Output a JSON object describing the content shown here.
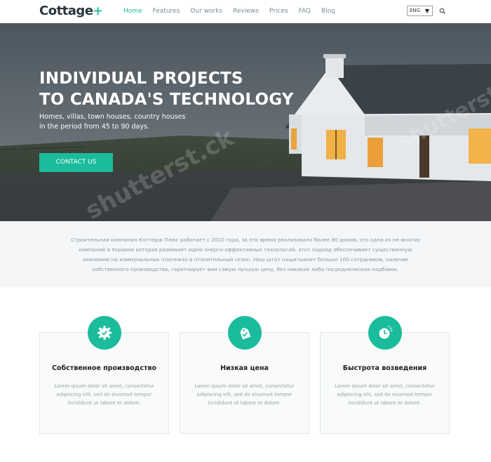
{
  "header": {
    "logo": "Cottage",
    "logo_plus": "+",
    "nav": [
      "Home",
      "Features",
      "Our works",
      "Reviews",
      "Prices",
      "FAQ",
      "Blog"
    ],
    "active_nav": "Home",
    "lang": "ENG"
  },
  "hero": {
    "title_line1": "INDIVIDUAL PROJECTS",
    "title_line2": "TO CANADA'S TECHNOLOGY",
    "sub_line1": "Homes, villas, town houses, country houses",
    "sub_line2": "in the period from 45 to 90 days.",
    "button": "CONTACT US"
  },
  "about": {
    "text": "Строительная компания Коттедж Плюс работает с 2010 года, за это время реализовали более 80 домов, это одна из не многих компаний в Украине которая развивает идею энерго-эффективных технологий, этот подход обеспечивает существенную экономию на коммунальных платежах в отопительный сезон. Наш штат нащитывает больше 100 сотрдников, наличие собственного производства, гаратнирует вам самую лучшую цену, без никаких либо посреднеческих надбавок."
  },
  "features": [
    {
      "icon": "gear-check-icon",
      "title": "Собственное производство",
      "text": "Lorem ipsum dolor sit amet, consectetur adipiscing elit, sed do eiusmod tempor incididunt ut labore et dolore."
    },
    {
      "icon": "price-tag-icon",
      "title": "Низкая цена",
      "text": "Lorem ipsum dolor sit amet, consectetur adipiscing elit, sed do eiusmod tempor incididunt ut labore et dolore."
    },
    {
      "icon": "clock-icon",
      "title": "Быстрота возведения",
      "text": "Lorem ipsum dolor sit amet, consectetur adipiscing elit, sed do eiusmod tempor incididunt ut labore et dolore."
    }
  ],
  "colors": {
    "accent": "#1abc9c",
    "dark": "#2a3640"
  }
}
